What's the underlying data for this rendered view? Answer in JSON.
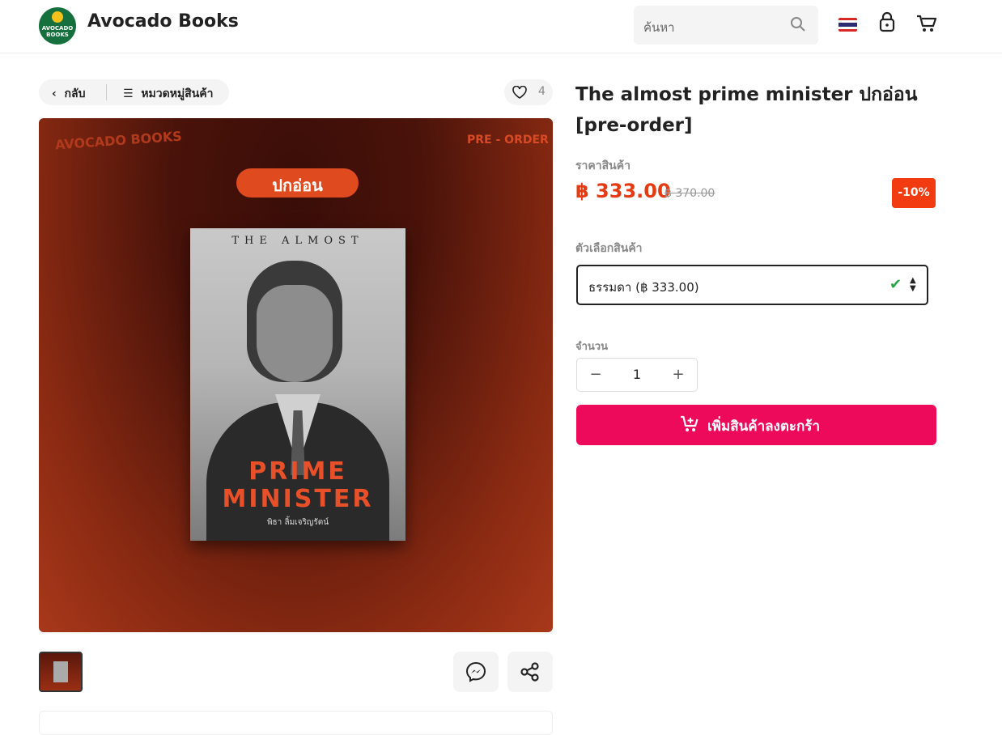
{
  "header": {
    "brand": "Avocado Books",
    "logo_text": "AVOCADO BOOKS",
    "search_placeholder": "ค้นหา",
    "flag_icon": "thailand-flag-icon",
    "icons": [
      "search-icon",
      "lock-icon",
      "cart-icon"
    ]
  },
  "nav": {
    "back_label": "กลับ",
    "categories_label": "หมวดหมู่สินค้า",
    "like_count": "4"
  },
  "hero": {
    "watermark": "AVOCADO BOOKS",
    "badge": "PRE - ORDER",
    "pill": "ปกอ่อน",
    "book_top": "THE ALMOST",
    "book_title_1": "PRIME",
    "book_title_2": "MINISTER",
    "book_author": "พิธา ลิ้มเจริญรัตน์"
  },
  "product": {
    "title": "The almost prime minister ปกอ่อน [pre-order]",
    "price_label": "ราคาสินค้า",
    "price": "฿ 333.00",
    "old_price": "฿ 370.00",
    "discount": "-10%",
    "option_label": "ตัวเลือกสินค้า",
    "option_value": "ธรรมดา (฿ 333.00)",
    "qty_label": "จำนวน",
    "qty_value": "1",
    "qty_minus": "−",
    "qty_plus": "+",
    "add_to_cart": "เพิ่มสินค้าลงตะกร้า"
  },
  "colors": {
    "accent": "#ee0a5b",
    "price": "#e53a12",
    "discount_bg": "#f23b10",
    "brand_green": "#16703d"
  }
}
